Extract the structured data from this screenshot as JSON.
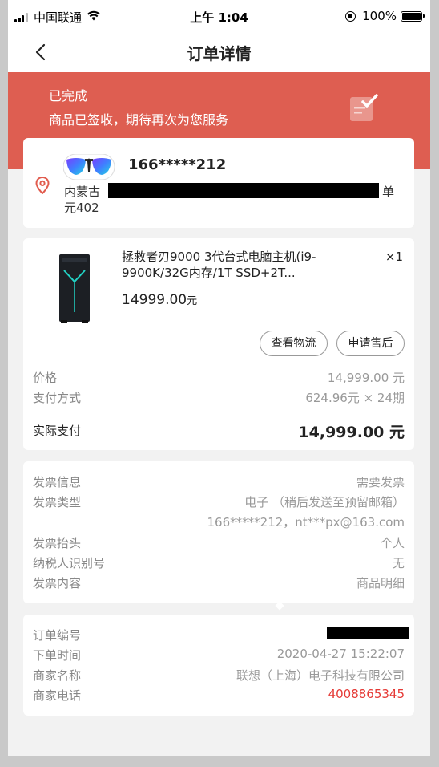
{
  "status_bar": {
    "carrier": "中国联通",
    "time": "上午 1:04",
    "battery": "100%",
    "battery_level": 1.0
  },
  "nav": {
    "title": "订单详情",
    "back_icon": "chevron-left-icon"
  },
  "banner": {
    "status": "已完成",
    "message": "商品已签收，期待再次为您服务",
    "icon": "order-check-icon",
    "color": "#de5e51"
  },
  "address": {
    "phone": "166*****212",
    "line1_prefix": "内蒙古",
    "line1_suffix": "单",
    "line2": "元402",
    "pin_icon": "location-pin-icon"
  },
  "product": {
    "name": "拯救者刃9000 3代台式电脑主机(i9-9900K/32G内存/1T SSD+2T...",
    "qty": "×1",
    "price_value": "14999.00",
    "price_unit": "元",
    "btn_logistics": "查看物流",
    "btn_aftersale": "申请售后",
    "rows": [
      {
        "label": "价格",
        "value": "14,999.00 元"
      },
      {
        "label": "支付方式",
        "value": "624.96元 × 24期"
      }
    ],
    "total_label": "实际支付",
    "total_value": "14,999.00 元"
  },
  "invoice": {
    "rows": [
      {
        "label": "发票信息",
        "value": "需要发票"
      },
      {
        "label": "发票类型",
        "value": "电子 （稍后发送至预留邮箱）"
      },
      {
        "label": "",
        "value": "166*****212，nt***px@163.com"
      },
      {
        "label": "发票抬头",
        "value": "个人"
      },
      {
        "label": "纳税人识别号",
        "value": "无"
      },
      {
        "label": "发票内容",
        "value": "商品明细"
      }
    ]
  },
  "order": {
    "rows": [
      {
        "label": "订单编号",
        "value": ""
      },
      {
        "label": "下单时间",
        "value": "2020-04-27 15:22:07"
      },
      {
        "label": "商家名称",
        "value": "联想（上海）电子科技有限公司"
      },
      {
        "label": "商家电话",
        "value": "4008865345"
      }
    ],
    "phone_color": "#e53935"
  }
}
